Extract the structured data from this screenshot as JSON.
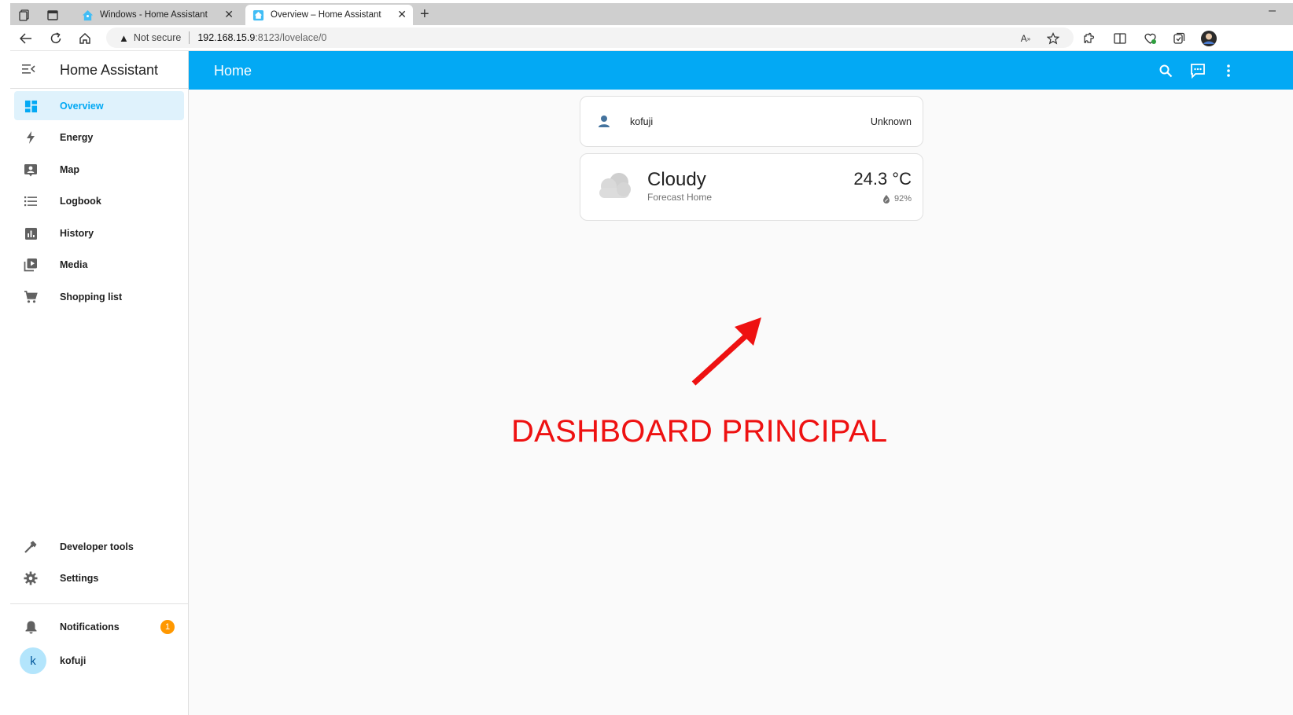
{
  "browser": {
    "tabs": [
      {
        "title": "Windows - Home Assistant",
        "active": false
      },
      {
        "title": "Overview – Home Assistant",
        "active": true
      }
    ],
    "address": {
      "security_label": "Not secure",
      "host": "192.168.15.9",
      "path": ":8123/lovelace/0"
    },
    "icons": [
      "workspaces-icon",
      "tab-actions-icon",
      "back-icon",
      "reload-icon",
      "home-icon",
      "read-aloud-icon",
      "favorite-icon",
      "extensions-icon",
      "split-screen-icon",
      "browser-essentials-icon",
      "collections-icon",
      "profile-icon"
    ]
  },
  "sidebar": {
    "title": "Home Assistant",
    "items": [
      {
        "label": "Overview",
        "icon": "dashboard-icon",
        "selected": true
      },
      {
        "label": "Energy",
        "icon": "lightning-icon"
      },
      {
        "label": "Map",
        "icon": "map-icon"
      },
      {
        "label": "Logbook",
        "icon": "logbook-icon"
      },
      {
        "label": "History",
        "icon": "history-chart-icon"
      },
      {
        "label": "Media",
        "icon": "media-icon"
      },
      {
        "label": "Shopping list",
        "icon": "cart-icon"
      }
    ],
    "bottom_items": [
      {
        "label": "Developer tools",
        "icon": "hammer-icon"
      },
      {
        "label": "Settings",
        "icon": "gear-icon"
      }
    ],
    "notifications": {
      "label": "Notifications",
      "count": "1"
    },
    "user": {
      "initial": "k",
      "name": "kofuji"
    }
  },
  "header": {
    "title": "Home",
    "accent_color": "#03a9f4"
  },
  "cards": {
    "person": {
      "name": "kofuji",
      "state": "Unknown"
    },
    "weather": {
      "condition": "Cloudy",
      "source": "Forecast Home",
      "temperature": "24.3 °C",
      "humidity": "92%"
    }
  },
  "annotation": {
    "text": "DASHBOARD PRINCIPAL",
    "color": "#ee1111"
  }
}
